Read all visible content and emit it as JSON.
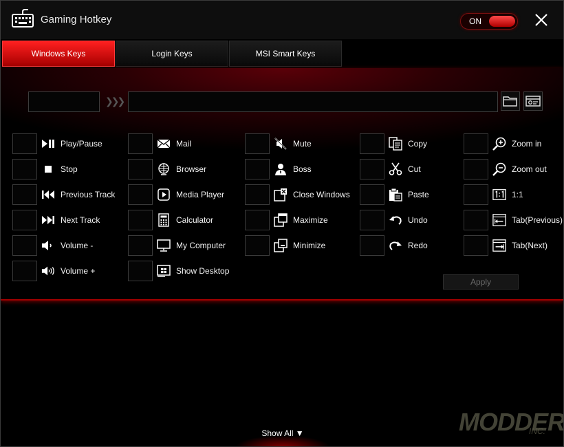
{
  "app": {
    "title": "Gaming Hotkey",
    "power_label": "ON"
  },
  "tabs": [
    {
      "label": "Windows Keys",
      "active": true
    },
    {
      "label": "Login Keys",
      "active": false
    },
    {
      "label": "MSI Smart Keys",
      "active": false
    }
  ],
  "colors": {
    "accent": "#e80000",
    "panel_glow": "#5a0008",
    "background": "#000000"
  },
  "hotkeys": {
    "col1": [
      {
        "label": "Play/Pause",
        "icon": "play-pause-icon"
      },
      {
        "label": "Stop",
        "icon": "stop-icon"
      },
      {
        "label": "Previous Track",
        "icon": "previous-track-icon"
      },
      {
        "label": "Next Track",
        "icon": "next-track-icon"
      },
      {
        "label": "Volume -",
        "icon": "volume-down-icon"
      },
      {
        "label": "Volume +",
        "icon": "volume-up-icon"
      }
    ],
    "col2": [
      {
        "label": "Mail",
        "icon": "mail-icon"
      },
      {
        "label": "Browser",
        "icon": "globe-icon"
      },
      {
        "label": "Media Player",
        "icon": "media-player-icon"
      },
      {
        "label": "Calculator",
        "icon": "calculator-icon"
      },
      {
        "label": "My Computer",
        "icon": "monitor-icon"
      },
      {
        "label": "Show Desktop",
        "icon": "show-desktop-icon"
      }
    ],
    "col3": [
      {
        "label": "Mute",
        "icon": "mute-icon"
      },
      {
        "label": "Boss",
        "icon": "boss-icon"
      },
      {
        "label": "Close Windows",
        "icon": "close-window-icon"
      },
      {
        "label": "Maximize",
        "icon": "maximize-icon"
      },
      {
        "label": "Minimize",
        "icon": "minimize-icon"
      }
    ],
    "col4": [
      {
        "label": "Copy",
        "icon": "copy-icon"
      },
      {
        "label": "Cut",
        "icon": "scissors-icon"
      },
      {
        "label": "Paste",
        "icon": "paste-icon"
      },
      {
        "label": "Undo",
        "icon": "undo-icon"
      },
      {
        "label": "Redo",
        "icon": "redo-icon"
      }
    ],
    "col5": [
      {
        "label": "Zoom in",
        "icon": "zoom-in-icon"
      },
      {
        "label": "Zoom out",
        "icon": "zoom-out-icon"
      },
      {
        "label": "1:1",
        "icon": "actual-size-icon"
      },
      {
        "label": "Tab(Previous)",
        "icon": "tab-previous-icon"
      },
      {
        "label": "Tab(Next)",
        "icon": "tab-next-icon"
      }
    ]
  },
  "apply_label": "Apply",
  "show_all_label": "Show All ▼",
  "watermark": {
    "text": "MODDERS",
    "sub": "INC."
  }
}
